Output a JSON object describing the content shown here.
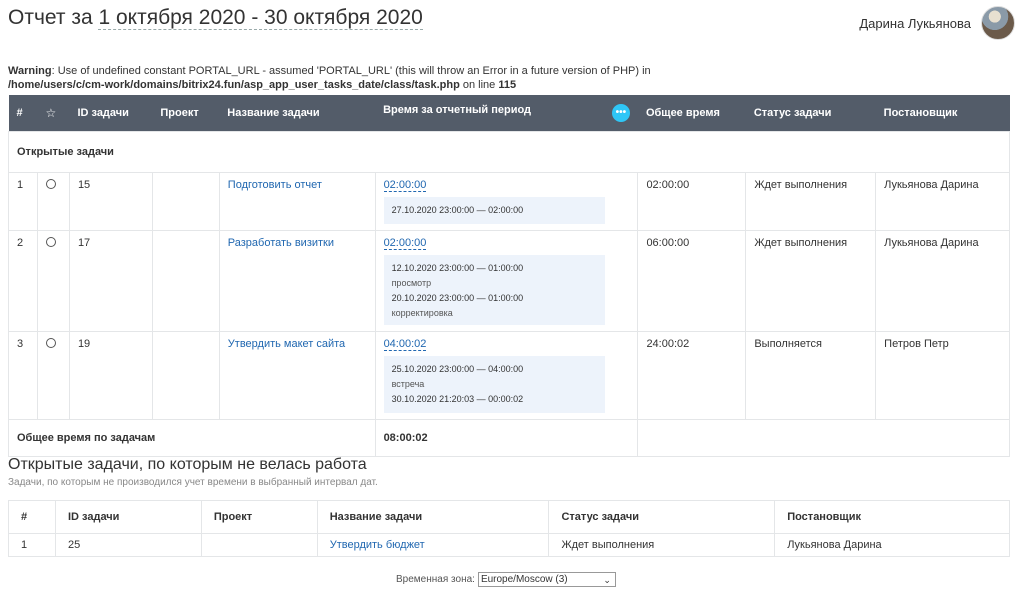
{
  "header": {
    "title_prefix": "Отчет за",
    "period": "1 октября 2020 - 30 октября 2020",
    "user_name": "Дарина Лукьянова"
  },
  "warning": {
    "label": "Warning",
    "text": ": Use of undefined constant PORTAL_URL - assumed 'PORTAL_URL' (this will throw an Error in a future version of PHP) in ",
    "path": "/home/users/c/cm-work/domains/bitrix24.fun/asp_app_user_tasks_date/class/task.php",
    "on_line": " on line ",
    "line": "115"
  },
  "main_table": {
    "columns": [
      "#",
      "☆",
      "ID задачи",
      "Проект",
      "Название задачи",
      "Время за отчетный период",
      "Общее время",
      "Статус задачи",
      "Постановщик"
    ],
    "group_label": "Открытые задачи",
    "rows": [
      {
        "num": "1",
        "id": "15",
        "project": "",
        "name": "Подготовить отчет",
        "period_time": "02:00:00",
        "logs": [
          {
            "range": "27.10.2020 23:00:00 — 02:00:00",
            "comment": ""
          }
        ],
        "total": "02:00:00",
        "status": "Ждет выполнения",
        "creator": "Лукьянова Дарина"
      },
      {
        "num": "2",
        "id": "17",
        "project": "",
        "name": "Разработать визитки",
        "period_time": "02:00:00",
        "logs": [
          {
            "range": "12.10.2020 23:00:00 — 01:00:00",
            "comment": "просмотр"
          },
          {
            "range": "20.10.2020 23:00:00 — 01:00:00",
            "comment": "корректировка"
          }
        ],
        "total": "06:00:00",
        "status": "Ждет выполнения",
        "creator": "Лукьянова Дарина"
      },
      {
        "num": "3",
        "id": "19",
        "project": "",
        "name": "Утвердить макет сайта",
        "period_time": "04:00:02",
        "logs": [
          {
            "range": "25.10.2020 23:00:00 — 04:00:00",
            "comment": "встреча"
          },
          {
            "range": "30.10.2020 21:20:03 — 00:00:02",
            "comment": ""
          }
        ],
        "total": "24:00:02",
        "status": "Выполняется",
        "creator": "Петров Петр"
      }
    ],
    "total_label": "Общее время по задачам",
    "total_value": "08:00:02"
  },
  "section2": {
    "title": "Открытые задачи, по которым не велась работа",
    "subtitle": "Задачи, по которым не производился учет времени в выбранный интервал дат.",
    "columns": [
      "#",
      "ID задачи",
      "Проект",
      "Название задачи",
      "Статус задачи",
      "Постановщик"
    ],
    "rows": [
      {
        "num": "1",
        "id": "25",
        "project": "",
        "name": "Утвердить бюджет",
        "status": "Ждет выполнения",
        "creator": "Лукьянова Дарина"
      }
    ]
  },
  "timezone": {
    "label": "Временная зона:",
    "value": "Europe/Moscow (3)"
  },
  "colors": {
    "table_header_bg": "#535c69",
    "link": "#2067b0",
    "log_bg": "#edf3fb",
    "chat_icon": "#2fc6f6"
  }
}
